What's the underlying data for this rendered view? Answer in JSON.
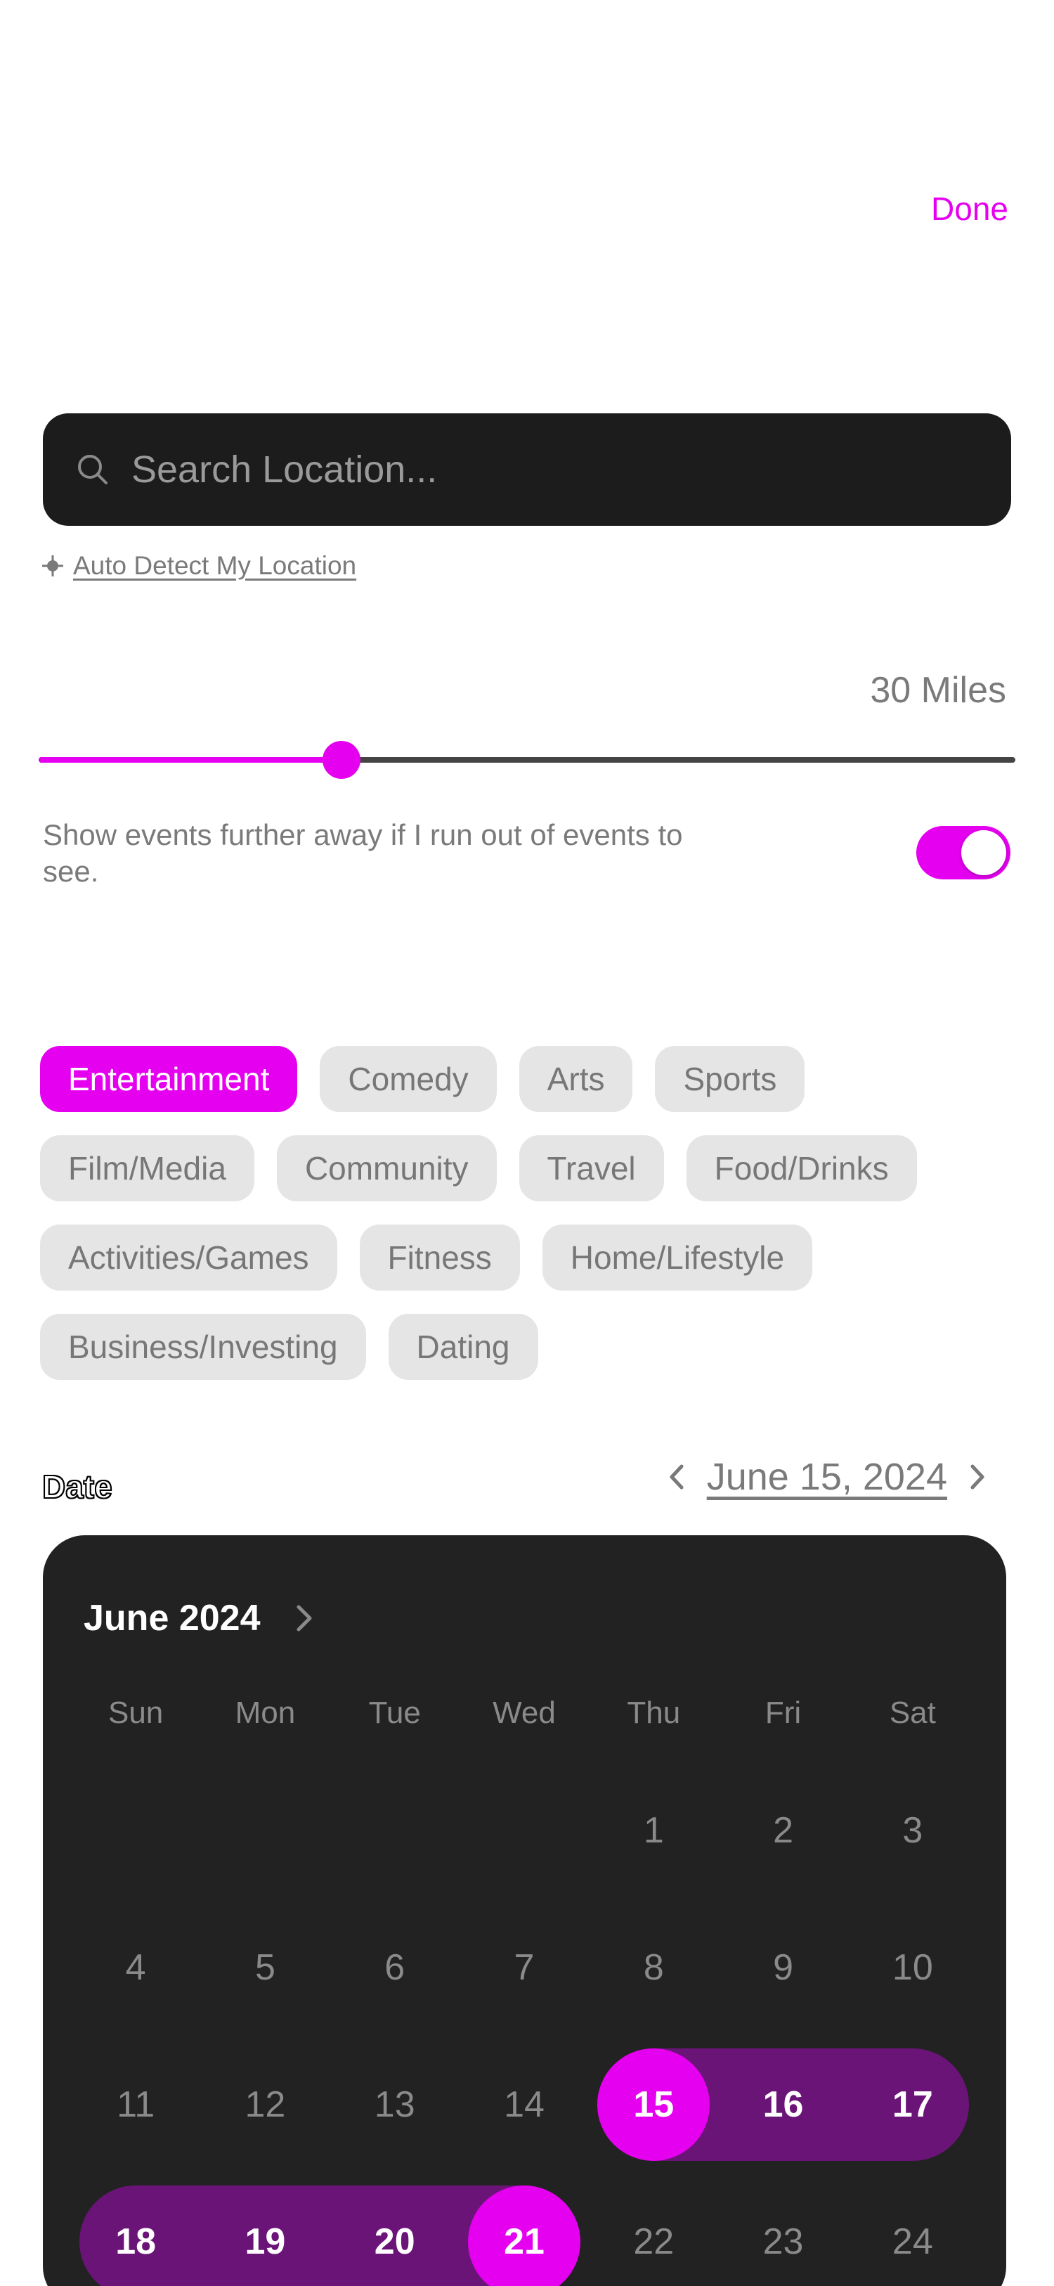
{
  "header": {
    "done_label": "Done"
  },
  "location": {
    "search_placeholder": "Search Location...",
    "auto_detect_label": "Auto Detect My Location"
  },
  "distance": {
    "value_label": "30 Miles",
    "slider_fraction": 0.31,
    "further_away_text": "Show events further away if I run out of events to see.",
    "further_away_enabled": true
  },
  "categories": {
    "rows": [
      [
        {
          "label": "Entertainment",
          "selected": true
        },
        {
          "label": "Comedy",
          "selected": false
        },
        {
          "label": "Arts",
          "selected": false
        },
        {
          "label": "Sports",
          "selected": false
        }
      ],
      [
        {
          "label": "Film/Media",
          "selected": false
        },
        {
          "label": "Community",
          "selected": false
        },
        {
          "label": "Travel",
          "selected": false
        },
        {
          "label": "Food/Drinks",
          "selected": false
        }
      ],
      [
        {
          "label": "Activities/Games",
          "selected": false
        },
        {
          "label": "Fitness",
          "selected": false
        },
        {
          "label": "Home/Lifestyle",
          "selected": false
        }
      ],
      [
        {
          "label": "Business/Investing",
          "selected": false
        },
        {
          "label": "Dating",
          "selected": false
        }
      ]
    ]
  },
  "date": {
    "label": "Date",
    "selected_text": "June 15, 2024"
  },
  "calendar": {
    "month_label": "June 2024",
    "weekdays": [
      "Sun",
      "Mon",
      "Tue",
      "Wed",
      "Thu",
      "Fri",
      "Sat"
    ],
    "weeks": [
      [
        "",
        "",
        "",
        "",
        "1",
        "2",
        "3"
      ],
      [
        "4",
        "5",
        "6",
        "7",
        "8",
        "9",
        "10"
      ],
      [
        "11",
        "12",
        "13",
        "14",
        "15",
        "16",
        "17"
      ],
      [
        "18",
        "19",
        "20",
        "21",
        "22",
        "23",
        "24"
      ]
    ],
    "range_start": 15,
    "range_end": 21
  },
  "colors": {
    "accent": "#e600f0",
    "range_band": "#6b1478",
    "calendar_bg": "#222222",
    "search_bg": "#1c1c1c",
    "chip_bg": "#e5e5e5"
  },
  "icons": {
    "search": "search-icon",
    "locate": "crosshair-icon",
    "prev": "chevron-left-icon",
    "next": "chevron-right-icon"
  }
}
